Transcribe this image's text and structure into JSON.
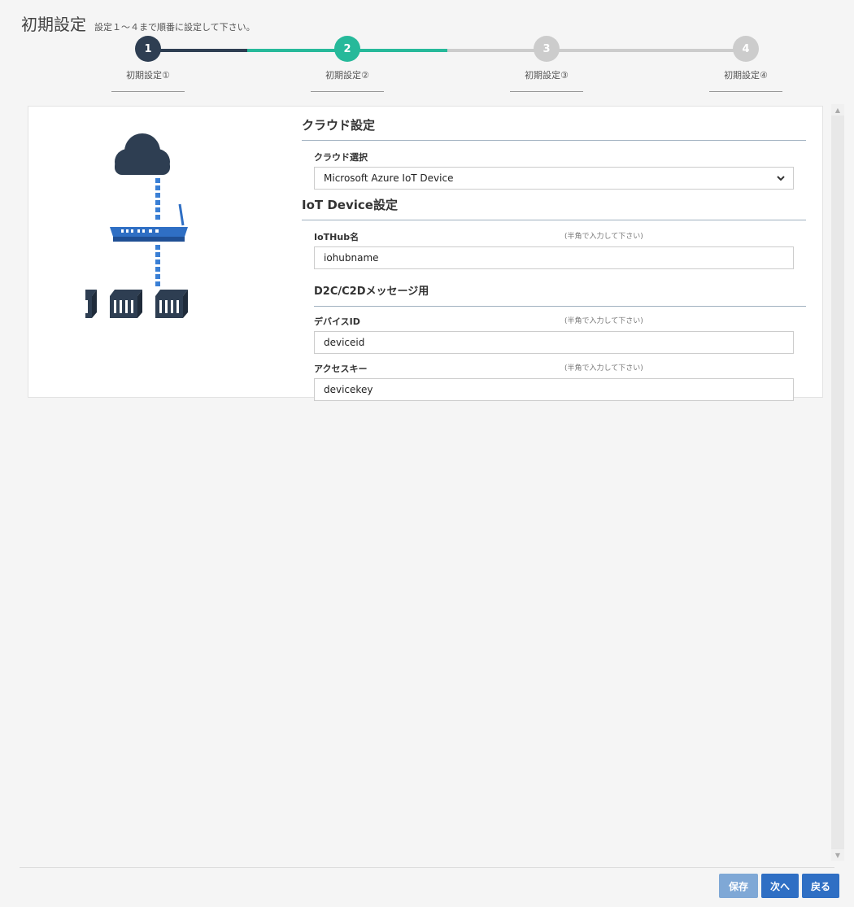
{
  "header": {
    "title": "初期設定",
    "subtitle": "設定１～４まで順番に設定して下さい。"
  },
  "stepper": {
    "steps": [
      {
        "number": "1",
        "label": "初期設定①",
        "state": "done",
        "color": "#2e3e52"
      },
      {
        "number": "2",
        "label": "初期設定②",
        "state": "current",
        "color": "#26b99a"
      },
      {
        "number": "3",
        "label": "初期設定③",
        "state": "pending",
        "color": "#cccccc"
      },
      {
        "number": "4",
        "label": "初期設定④",
        "state": "pending",
        "color": "#cccccc"
      }
    ]
  },
  "illustration": {
    "icons": [
      "cloud-icon",
      "router-icon",
      "plc-device-icon"
    ],
    "cloud_color": "#2e3e52",
    "link_color": "#3a7fd5",
    "router_color": "#2f6fc4"
  },
  "form": {
    "cloud_section_title": "クラウド設定",
    "cloud_select_label": "クラウド選択",
    "cloud_select_value": "Microsoft Azure IoT Device",
    "device_section_title": "IoT Device設定",
    "iothub_label": "IoTHub名",
    "iothub_hint": "(半角で入力して下さい)",
    "iothub_value": "iohubname",
    "message_section_title": "D2C/C2Dメッセージ用",
    "device_id_label": "デバイスID",
    "device_id_hint": "(半角で入力して下さい)",
    "device_id_value": "deviceid",
    "access_key_label": "アクセスキー",
    "access_key_hint": "(半角で入力して下さい)",
    "access_key_value": "devicekey"
  },
  "footer": {
    "save_label": "保存",
    "next_label": "次へ",
    "back_label": "戻る",
    "save_color": "#7fa8d6",
    "primary_color": "#2f6fc4"
  }
}
